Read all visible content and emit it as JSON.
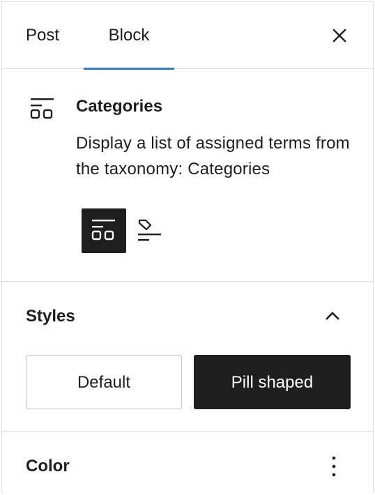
{
  "tabs": [
    {
      "label": "Post"
    },
    {
      "label": "Block"
    }
  ],
  "header": {
    "close_icon": "close-icon"
  },
  "block": {
    "icon": "categories-icon",
    "title": "Categories",
    "description": "Display a list of assigned terms from the taxonomy: Categories",
    "variations": [
      {
        "icon": "categories-icon",
        "active": true
      },
      {
        "icon": "tag-icon",
        "active": false
      }
    ]
  },
  "styles": {
    "title": "Styles",
    "toggle_icon": "chevron-up-icon",
    "options": [
      {
        "label": "Default",
        "selected": false
      },
      {
        "label": "Pill shaped",
        "selected": true
      }
    ]
  },
  "color": {
    "title": "Color",
    "menu_icon": "vertical-ellipsis-icon"
  },
  "colors": {
    "accent": "#3a78b9",
    "dark": "#1e1e1e",
    "border": "#dcdcde"
  }
}
